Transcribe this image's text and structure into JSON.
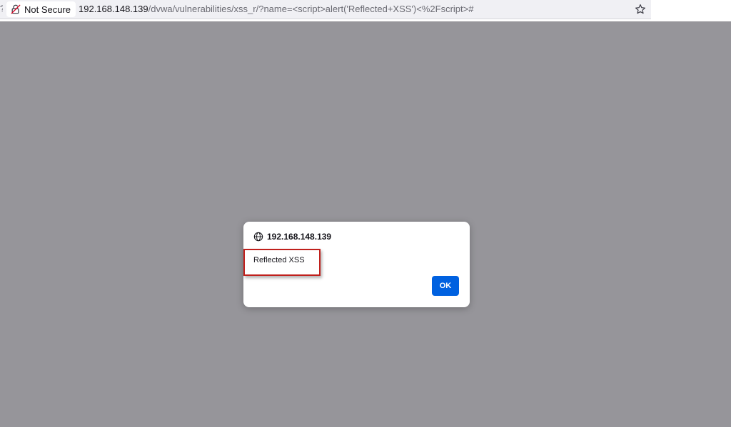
{
  "address_bar": {
    "security_label": "Not Secure",
    "url_host": "192.168.148.139",
    "url_path": "/dvwa/vulnerabilities/xss_r/?name=<script>alert('Reflected+XSS')<%2Fscript>#",
    "back_glyph": "?"
  },
  "icons": {
    "security": "broken-lock-icon",
    "bookmark": "star-icon",
    "origin": "globe-icon"
  },
  "dialog": {
    "origin": "192.168.148.139",
    "message": "Reflected XSS",
    "ok_label": "OK"
  },
  "colors": {
    "page_overlay": "#96959a",
    "ok_button": "#0061e0",
    "highlight_box": "#c0201c",
    "insecure_lock": "#d70022"
  }
}
